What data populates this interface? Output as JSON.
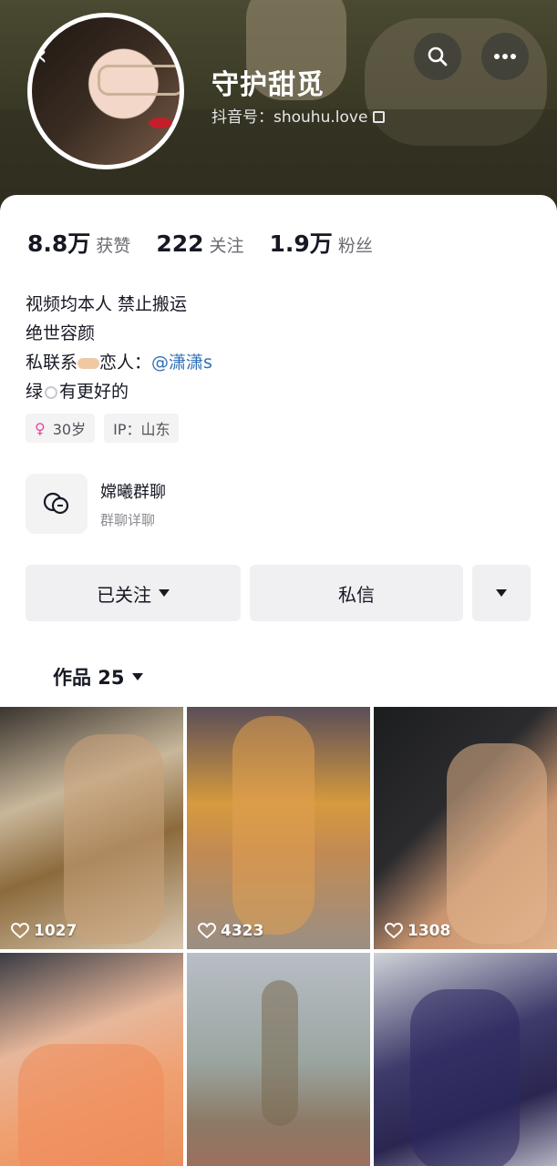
{
  "header": {
    "title": "守护甜觅",
    "handle": "抖音号：shouhu.love"
  },
  "stats": [
    {
      "value": "8.8万",
      "label": "获赞"
    },
    {
      "value": "222",
      "label": "关注"
    },
    {
      "value": "1.9万",
      "label": "粉丝"
    }
  ],
  "bio": {
    "line1": "视频均本人 禁止搬运",
    "line2": "绝世容颜",
    "line3_prefix": "私联系",
    "line3_mid": "恋人：",
    "line3_mention": "@潇潇s",
    "line4_prefix": "绿",
    "line4_suffix": "有更好的"
  },
  "tags": {
    "age": "30岁",
    "ip": "IP：山东"
  },
  "group": {
    "title": "嫦曦群聊",
    "subtitle": "群聊详聊"
  },
  "actions": {
    "follow_label": "已关注",
    "message_label": "私信"
  },
  "works": {
    "label": "作品 25"
  },
  "videos": [
    {
      "likes": "1027"
    },
    {
      "likes": "4323"
    },
    {
      "likes": "1308"
    },
    {
      "likes": ""
    },
    {
      "likes": ""
    },
    {
      "likes": ""
    }
  ],
  "icons": {
    "search": "search-icon",
    "more": "more-icon",
    "back": "back-arrow-icon",
    "copy": "copy-icon",
    "group": "group-chat-icon",
    "heart": "heart-icon",
    "female": "female-icon"
  },
  "colors": {
    "mention": "#2f6fb5",
    "female": "#e8479b",
    "button_bg": "#f0f0f2"
  }
}
